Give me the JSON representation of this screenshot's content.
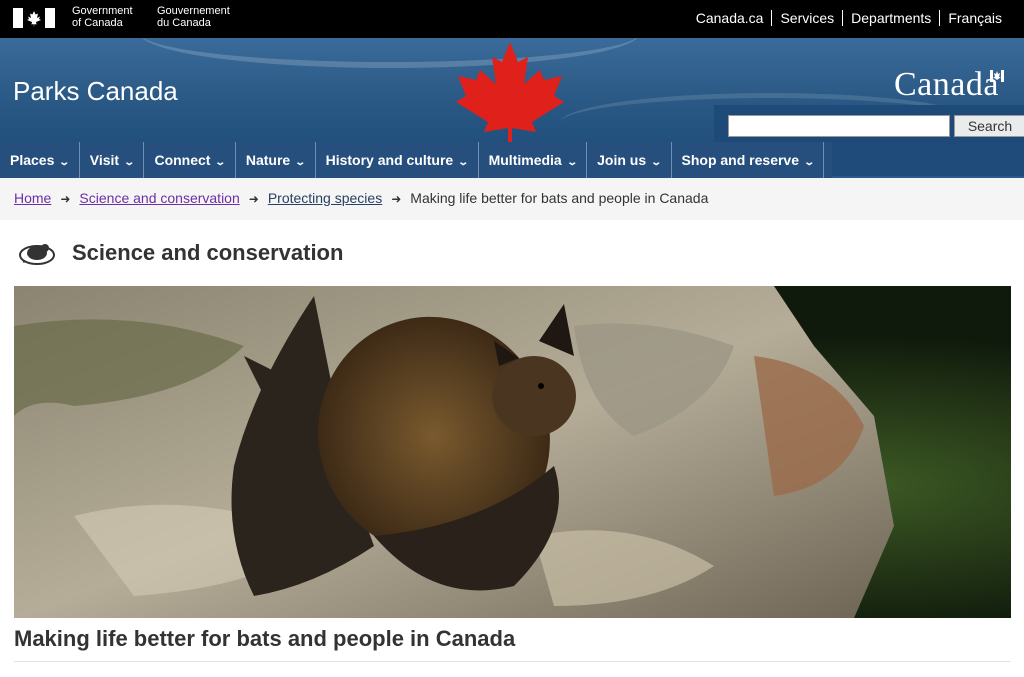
{
  "fip": {
    "gov_en_line1": "Government",
    "gov_en_line2": "of Canada",
    "gov_fr_line1": "Gouvernement",
    "gov_fr_line2": "du Canada",
    "links": [
      "Canada.ca",
      "Services",
      "Departments",
      "Français"
    ]
  },
  "banner": {
    "site_title": "Parks Canada",
    "wordmark": "Canada",
    "search_placeholder": "",
    "search_button": "Search"
  },
  "nav": {
    "items": [
      "Places",
      "Visit",
      "Connect",
      "Nature",
      "History and culture",
      "Multimedia",
      "Join us",
      "Shop and reserve"
    ]
  },
  "breadcrumb": {
    "items": [
      "Home",
      "Science and conservation",
      "Protecting species"
    ],
    "current": "Making life better for bats and people in Canada"
  },
  "section": {
    "title": "Science and conservation"
  },
  "hero": {
    "alt_icon": "bat-photo"
  },
  "page": {
    "title": "Making life better for bats and people in Canada"
  },
  "colors": {
    "nav_bg": "#264f7e",
    "banner_bg": "#2c5a86",
    "maple_red": "#e0201b",
    "visited_link": "#6e2fa6"
  }
}
